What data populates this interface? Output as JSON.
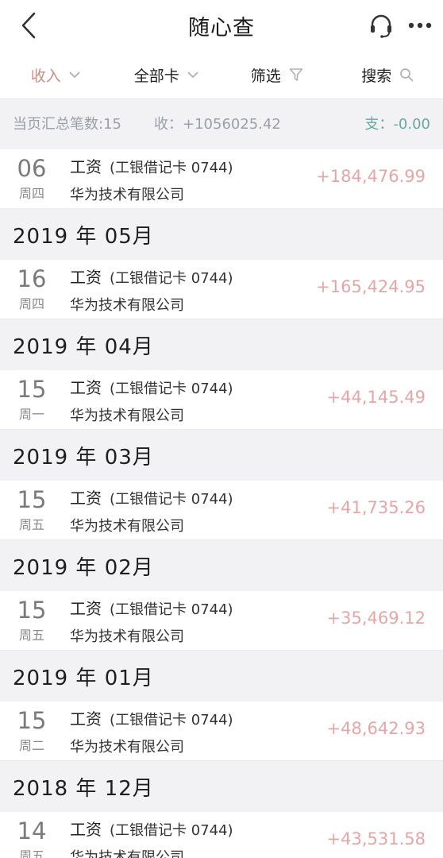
{
  "header": {
    "title": "随心查",
    "back_icon": "chevron-left-icon",
    "support_icon": "headset-icon",
    "more_icon": "more-dots-icon"
  },
  "filters": {
    "income": "收入",
    "all_cards": "全部卡",
    "screen": "筛选",
    "search": "搜索"
  },
  "summary": {
    "count_text": "当页汇总笔数:15",
    "income_text": "收：+1056025.42",
    "expense_text": "支：-0.00"
  },
  "records_top": {
    "day": "06",
    "weekday": "周四",
    "type": "工资",
    "card": "(工银借记卡 0744)",
    "company": "华为技术有限公司",
    "amount": "+184,476.99"
  },
  "months": [
    {
      "label": "2019 年 05月",
      "record": {
        "day": "16",
        "weekday": "周四",
        "type": "工资",
        "card": "(工银借记卡 0744)",
        "company": "华为技术有限公司",
        "amount": "+165,424.95"
      }
    },
    {
      "label": "2019 年 04月",
      "record": {
        "day": "15",
        "weekday": "周一",
        "type": "工资",
        "card": "(工银借记卡 0744)",
        "company": "华为技术有限公司",
        "amount": "+44,145.49"
      }
    },
    {
      "label": "2019 年 03月",
      "record": {
        "day": "15",
        "weekday": "周五",
        "type": "工资",
        "card": "(工银借记卡 0744)",
        "company": "华为技术有限公司",
        "amount": "+41,735.26"
      }
    },
    {
      "label": "2019 年 02月",
      "record": {
        "day": "15",
        "weekday": "周五",
        "type": "工资",
        "card": "(工银借记卡 0744)",
        "company": "华为技术有限公司",
        "amount": "+35,469.12"
      }
    },
    {
      "label": "2019 年 01月",
      "record": {
        "day": "15",
        "weekday": "周二",
        "type": "工资",
        "card": "(工银借记卡 0744)",
        "company": "华为技术有限公司",
        "amount": "+48,642.93"
      }
    },
    {
      "label": "2018 年 12月",
      "record": {
        "day": "14",
        "weekday": "周五",
        "type": "工资",
        "card": "(工银借记卡 0744)",
        "company": "华为技术有限公司",
        "amount": "+43,531.58"
      }
    }
  ],
  "colors": {
    "income_accent": "#c98f86",
    "amount": "#e4a6a6",
    "expense": "#6aa6a2"
  }
}
